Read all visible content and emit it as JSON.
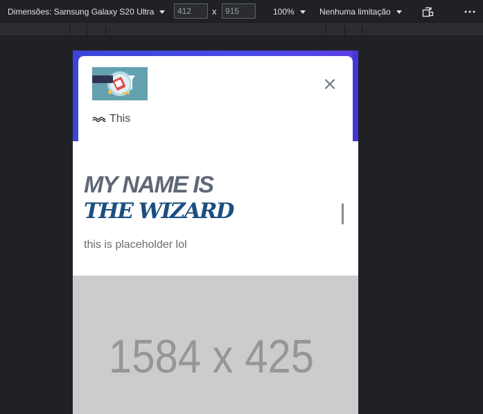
{
  "toolbar": {
    "dimensions_label": "Dimensões: Samsung Galaxy S20 Ultra",
    "width_value": "412",
    "times": "x",
    "height_value": "915",
    "zoom_label": "100%",
    "throttle_label": "Nenhuma limitação",
    "icons": [
      "rotate-icon",
      "more-options-icon"
    ]
  },
  "page": {
    "nav_item": "This",
    "heading_line1": "MY NAME IS",
    "heading_line2": "THE WIZARD",
    "subtext": "this is placeholder lol",
    "banner_placeholder": "1584 x 425",
    "colors": {
      "band": "#3a45d8",
      "heading_gray": "#5f6875",
      "heading_blue": "#1b4f80",
      "banner_bg": "#cccccc",
      "banner_text": "#969696",
      "logo_bg": "#63a0b0"
    }
  }
}
